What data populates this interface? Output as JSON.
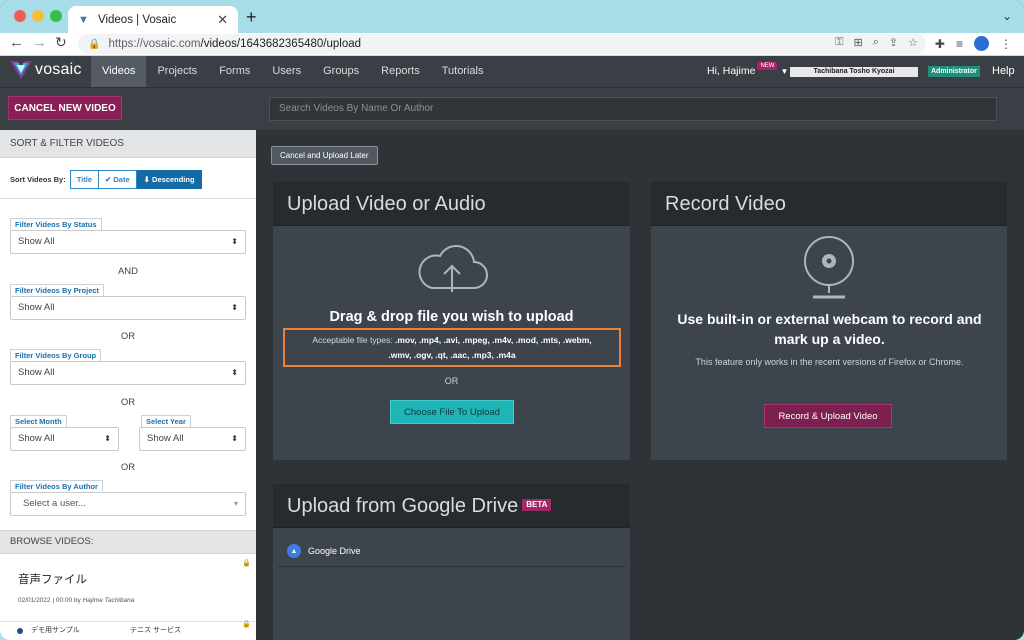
{
  "browser": {
    "tab_title": "Videos | Vosaic",
    "tab_close": "✕",
    "new_tab": "+",
    "url_host": "https://vosaic.com",
    "url_path": "/videos/1643682365480/upload"
  },
  "nav": {
    "logo_text": "vosaic",
    "items": [
      {
        "label": "Videos",
        "active": true
      },
      {
        "label": "Projects"
      },
      {
        "label": "Forms"
      },
      {
        "label": "Users"
      },
      {
        "label": "Groups"
      },
      {
        "label": "Reports"
      },
      {
        "label": "Tutorials"
      }
    ],
    "greeting": "Hi, Hajime",
    "new_badge": "NEW",
    "org": "Tachibana Tosho Kyozai",
    "role": "Administrator",
    "help": "Help"
  },
  "toolbar": {
    "cancel_new_video": "CANCEL NEW VIDEO",
    "search_placeholder": "Search Videos By Name Or Author"
  },
  "sidebar": {
    "heading": "SORT & FILTER VIDEOS",
    "sort_label": "Sort Videos By:",
    "sort_title": "Title",
    "sort_date": "Date",
    "sort_order": "Descending",
    "status_label": "Filter Videos By Status",
    "status_value": "Show All",
    "and": "AND",
    "project_label": "Filter Videos By Project",
    "project_value": "Show All",
    "or1": "OR",
    "group_label": "Filter Videos By Group",
    "group_value": "Show All",
    "or2": "OR",
    "month_label": "Select Month",
    "month_value": "Show All",
    "year_label": "Select Year",
    "year_value": "Show All",
    "or3": "OR",
    "author_label": "Filter Videos By Author",
    "author_placeholder": "Select a user...",
    "browse_heading": "BROWSE VIDEOS:",
    "video_title": "音声ファイル",
    "video_date": "02/01/2022 | 00:00 by",
    "video_author": "Hajime Tachibana",
    "video2_a": "デモ用サンプル",
    "video2_b": "テニス サービス"
  },
  "main": {
    "cancel_upload_later": "Cancel and Upload Later",
    "upload_heading": "Upload Video or Audio",
    "drag_title": "Drag & drop file you wish to upload",
    "accept_prefix": "Acceptable file types:",
    "accept_types_1": ".mov, .mp4, .avi, .mpeg, .m4v, .mod, .mts, .webm,",
    "accept_types_2": ".wmv, .ogv, .qt, .aac, .mp3, .m4a",
    "or": "OR",
    "choose_button": "Choose File To Upload",
    "record_heading": "Record Video",
    "record_desc": "Use built-in or external webcam to record and mark up a video.",
    "record_note": "This feature only works in the recent versions of Firefox or Chrome.",
    "record_button": "Record & Upload Video",
    "gdrive_heading": "Upload from Google Drive",
    "beta": "BETA",
    "gdrive_label": "Google Drive"
  }
}
